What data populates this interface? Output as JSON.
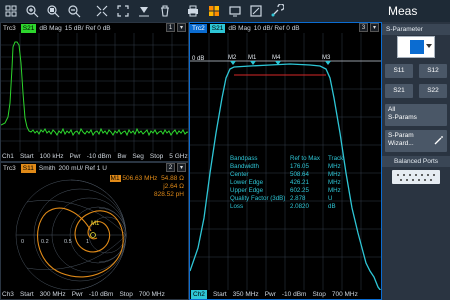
{
  "toolbar": {
    "icons": [
      "grid-icon",
      "zoom-in-icon",
      "zoom-region-icon",
      "zoom-out-icon",
      "fit-icon",
      "expand-icon",
      "marker-icon",
      "delete-icon",
      "print-icon",
      "windows-icon",
      "display-icon",
      "fullscreen-icon",
      "settings-icon"
    ]
  },
  "colors": {
    "accent": "#0b6cd1",
    "green": "#2dd62d",
    "cyan": "#2ec6d6",
    "orange": "#e08a18",
    "yellow": "#e9e23a",
    "red": "#d62828"
  },
  "pane1": {
    "trc": "Trc3",
    "param": "S21",
    "fmt": "dB Mag",
    "scale": "15 dB/ Ref 0 dB",
    "num": "1",
    "footer": {
      "ch": "Ch1",
      "start": "Start",
      "start_val": "100 kHz",
      "pwr": "Pwr",
      "pwr_val": "-10 dBm",
      "bw": "Bw",
      "seg": "Seg",
      "stop": "Stop",
      "stop_val": "5 GHz"
    }
  },
  "pane2": {
    "trc": "Trc3",
    "param": "S11",
    "fmt": "Smith",
    "scale": "200 mU/ Ref 1 U",
    "num": "2",
    "marker": {
      "name": "M1",
      "freq": "506.63 MHz",
      "v1": "54.88 Ω",
      "v2": "j2.64 Ω",
      "v3": "828.52 pH"
    },
    "ticks": [
      "0",
      "0.2",
      "0.5",
      "1"
    ],
    "footer": {
      "ch": "Ch3",
      "start": "Start",
      "start_val": "300 MHz",
      "pwr": "Pwr",
      "pwr_val": "-10 dBm",
      "stop": "Stop",
      "stop_val": "700 MHz"
    }
  },
  "pane3": {
    "trc": "Trc2",
    "param": "S21",
    "fmt": "dB Mag",
    "scale": "10 dB/ Ref 0 dB",
    "num": "3",
    "ref": "0 dB",
    "markers": [
      "M1",
      "M2",
      "M3",
      "M4"
    ],
    "table": {
      "rows": [
        {
          "label": "Bandpass",
          "val": "Ref to Max",
          "unit": "Track"
        },
        {
          "label": "Bandwidth",
          "val": "176.05",
          "unit": "MHz"
        },
        {
          "label": "Center",
          "val": "508.64",
          "unit": "MHz"
        },
        {
          "label": "Lower Edge",
          "val": "426.21",
          "unit": "MHz"
        },
        {
          "label": "Upper Edge",
          "val": "602.25",
          "unit": "MHz"
        },
        {
          "label": "Quality Factor (3dB)",
          "val": "2.878",
          "unit": "U"
        },
        {
          "label": "Loss",
          "val": "2.0820",
          "unit": "dB"
        }
      ]
    },
    "footer": {
      "ch": "Ch2",
      "start": "Start",
      "start_val": "350 MHz",
      "pwr": "Pwr",
      "pwr_val": "-10 dBm",
      "stop": "Stop",
      "stop_val": "700 MHz"
    }
  },
  "right": {
    "title": "Meas",
    "section_sparam": "S-Parameter",
    "selector_label": "S21",
    "buttons": [
      "S11",
      "S12",
      "S21",
      "S22"
    ],
    "all_sparams": "All\nS-Params",
    "wizard": "S-Param\nWizard...",
    "balanced": "Balanced Ports"
  }
}
